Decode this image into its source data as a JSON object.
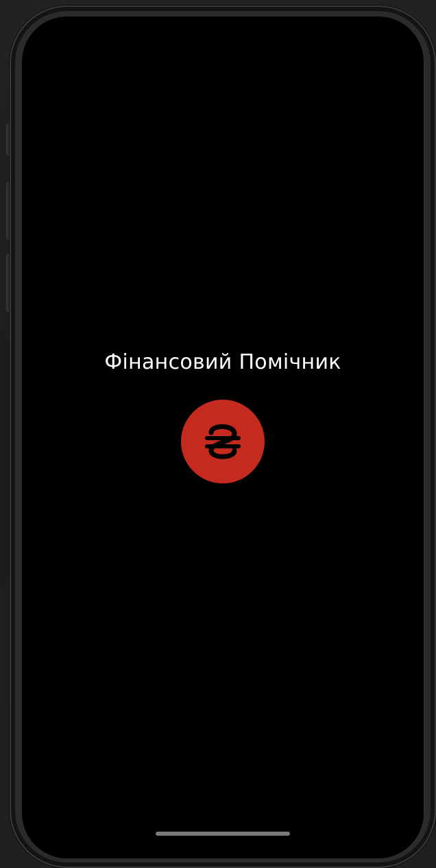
{
  "app": {
    "title": "Фінансовий Помічник"
  },
  "logo": {
    "icon": "hryvnia-sign-icon",
    "background_color": "#c42a1e",
    "glyph_color": "#000000"
  },
  "colors": {
    "screen_background": "#000000",
    "title_text": "#ffffff"
  }
}
